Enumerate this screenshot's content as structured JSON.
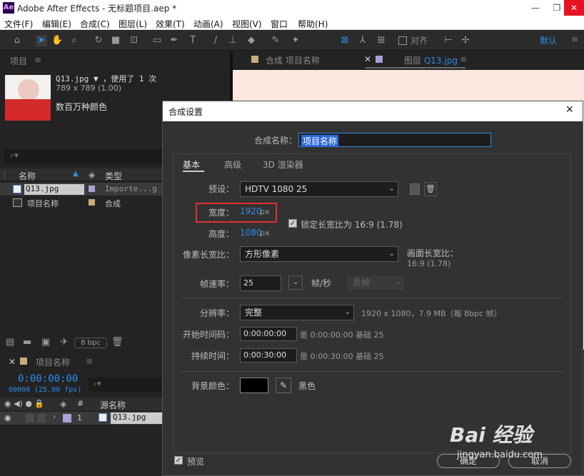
{
  "window": {
    "title": "Adobe After Effects - 无标题项目.aep *",
    "app_icon": "Ae",
    "min": "—",
    "restore": "❐",
    "close": "✕"
  },
  "menu": [
    "文件(F)",
    "编辑(E)",
    "合成(C)",
    "图层(L)",
    "效果(T)",
    "动画(A)",
    "视图(V)",
    "窗口",
    "帮助(H)"
  ],
  "toolbar": {
    "align_label": "对齐",
    "workspace_label": "默认"
  },
  "project": {
    "panel_title": "项目",
    "filename": "Q13.jpg ▼ ，使用了 1 次",
    "dims": "789 x 789 (1.00)",
    "colors": "数百万种颜色",
    "search_placeholder": "⌕▾",
    "col_name": "名称",
    "col_type": "类型",
    "items": [
      {
        "name": "Q13.jpg",
        "type": "Importe...g"
      },
      {
        "name": "项目名称",
        "type": "合成"
      }
    ],
    "bpc": "8 bpc"
  },
  "viewer": {
    "tab1": "合成 项目名称",
    "tab2": "图层",
    "tab2_name": "Q13.jpg"
  },
  "timeline": {
    "tab": "项目名称",
    "timecode": "0:00:00:00",
    "fps": "00000 (25.00 fps)",
    "col_num": "#",
    "col_source": "源名称",
    "layer_num": "1",
    "layer_name": "Q13.jpg"
  },
  "dialog": {
    "title": "合成设置",
    "close": "✕",
    "name_label": "合成名称：",
    "name_value": "项目名称",
    "tabs": [
      "基本",
      "高级",
      "3D 渲染器"
    ],
    "preset_label": "预设：",
    "preset_value": "HDTV 1080 25",
    "width_label": "宽度：",
    "width_value": "1920",
    "width_unit": "px",
    "height_label": "高度：",
    "height_value": "1080",
    "height_unit": "px",
    "lock_label": "锁定长宽比为 16:9 (1.78)",
    "par_label": "像素长宽比：",
    "par_value": "方形像素",
    "frame_ar_label": "画面长宽比：",
    "frame_ar_value": "16:9 (1.78)",
    "fps_label": "帧速率：",
    "fps_value": "25",
    "fps_unit": "帧/秒",
    "dropframe": "丢帧",
    "res_label": "分辨率：",
    "res_value": "完整",
    "res_info": "1920 x 1080，7.9 MB（每 8bpc 帧）",
    "start_label": "开始时间码：",
    "start_value": "0:00:00:00",
    "start_info": "是 0:00:00:00  基础 25",
    "dur_label": "持续时间：",
    "dur_value": "0:00:30:00",
    "dur_info": "是 0:00:30:00  基础 25",
    "bg_label": "背景颜色：",
    "bg_name": "黑色",
    "preview_label": "预览",
    "ok_label": "确定",
    "cancel_label": "取消"
  },
  "watermark": {
    "text": "Bai 经验",
    "url": "jingyan.baidu.com"
  },
  "colors": {
    "accent_blue": "#2d8ceb",
    "highlight_red": "#e23030",
    "dialog_bg": "#323232"
  }
}
